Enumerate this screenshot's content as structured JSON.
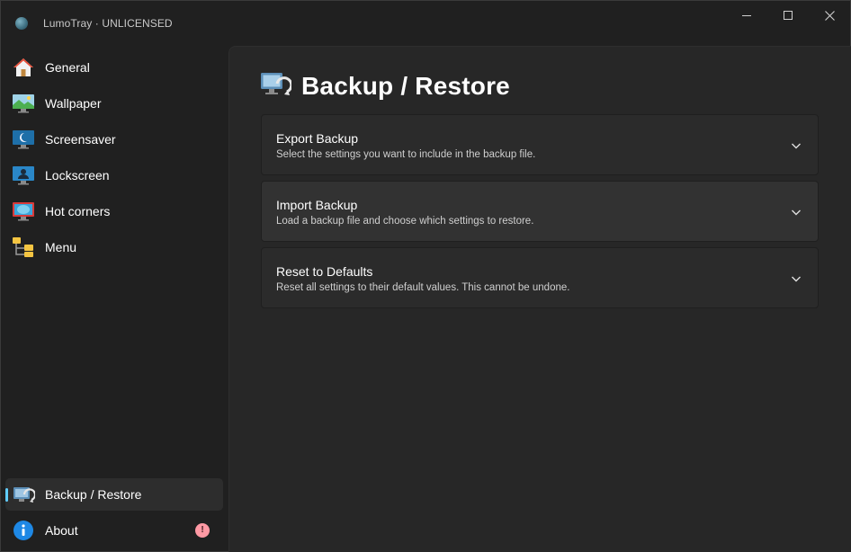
{
  "app": {
    "title": "LumoTray · UNLICENSED",
    "icon": "app-orb-icon"
  },
  "window_controls": {
    "minimize": "minimize-icon",
    "maximize": "maximize-icon",
    "close": "close-icon"
  },
  "sidebar": {
    "items": [
      {
        "label": "General",
        "icon": "home-icon"
      },
      {
        "label": "Wallpaper",
        "icon": "wallpaper-icon"
      },
      {
        "label": "Screensaver",
        "icon": "screensaver-icon"
      },
      {
        "label": "Lockscreen",
        "icon": "lockscreen-icon"
      },
      {
        "label": "Hot corners",
        "icon": "hot-corners-icon"
      },
      {
        "label": "Menu",
        "icon": "menu-folders-icon"
      }
    ],
    "footer_items": [
      {
        "label": "Backup / Restore",
        "icon": "backup-restore-icon",
        "selected": true
      },
      {
        "label": "About",
        "icon": "info-icon",
        "badge": "!"
      }
    ]
  },
  "page": {
    "title": "Backup / Restore",
    "icon": "backup-restore-icon",
    "cards": [
      {
        "title": "Export Backup",
        "description": "Select the settings you want to include in the backup file."
      },
      {
        "title": "Import Backup",
        "description": "Load a backup file and choose which settings to restore."
      },
      {
        "title": "Reset to Defaults",
        "description": "Reset all settings to their default values. This cannot be undone."
      }
    ]
  },
  "colors": {
    "accent": "#60cdff",
    "badge": "#ff99a4",
    "window_bg": "#202020",
    "content_bg": "#272727",
    "card_bg": "#2b2b2b"
  }
}
